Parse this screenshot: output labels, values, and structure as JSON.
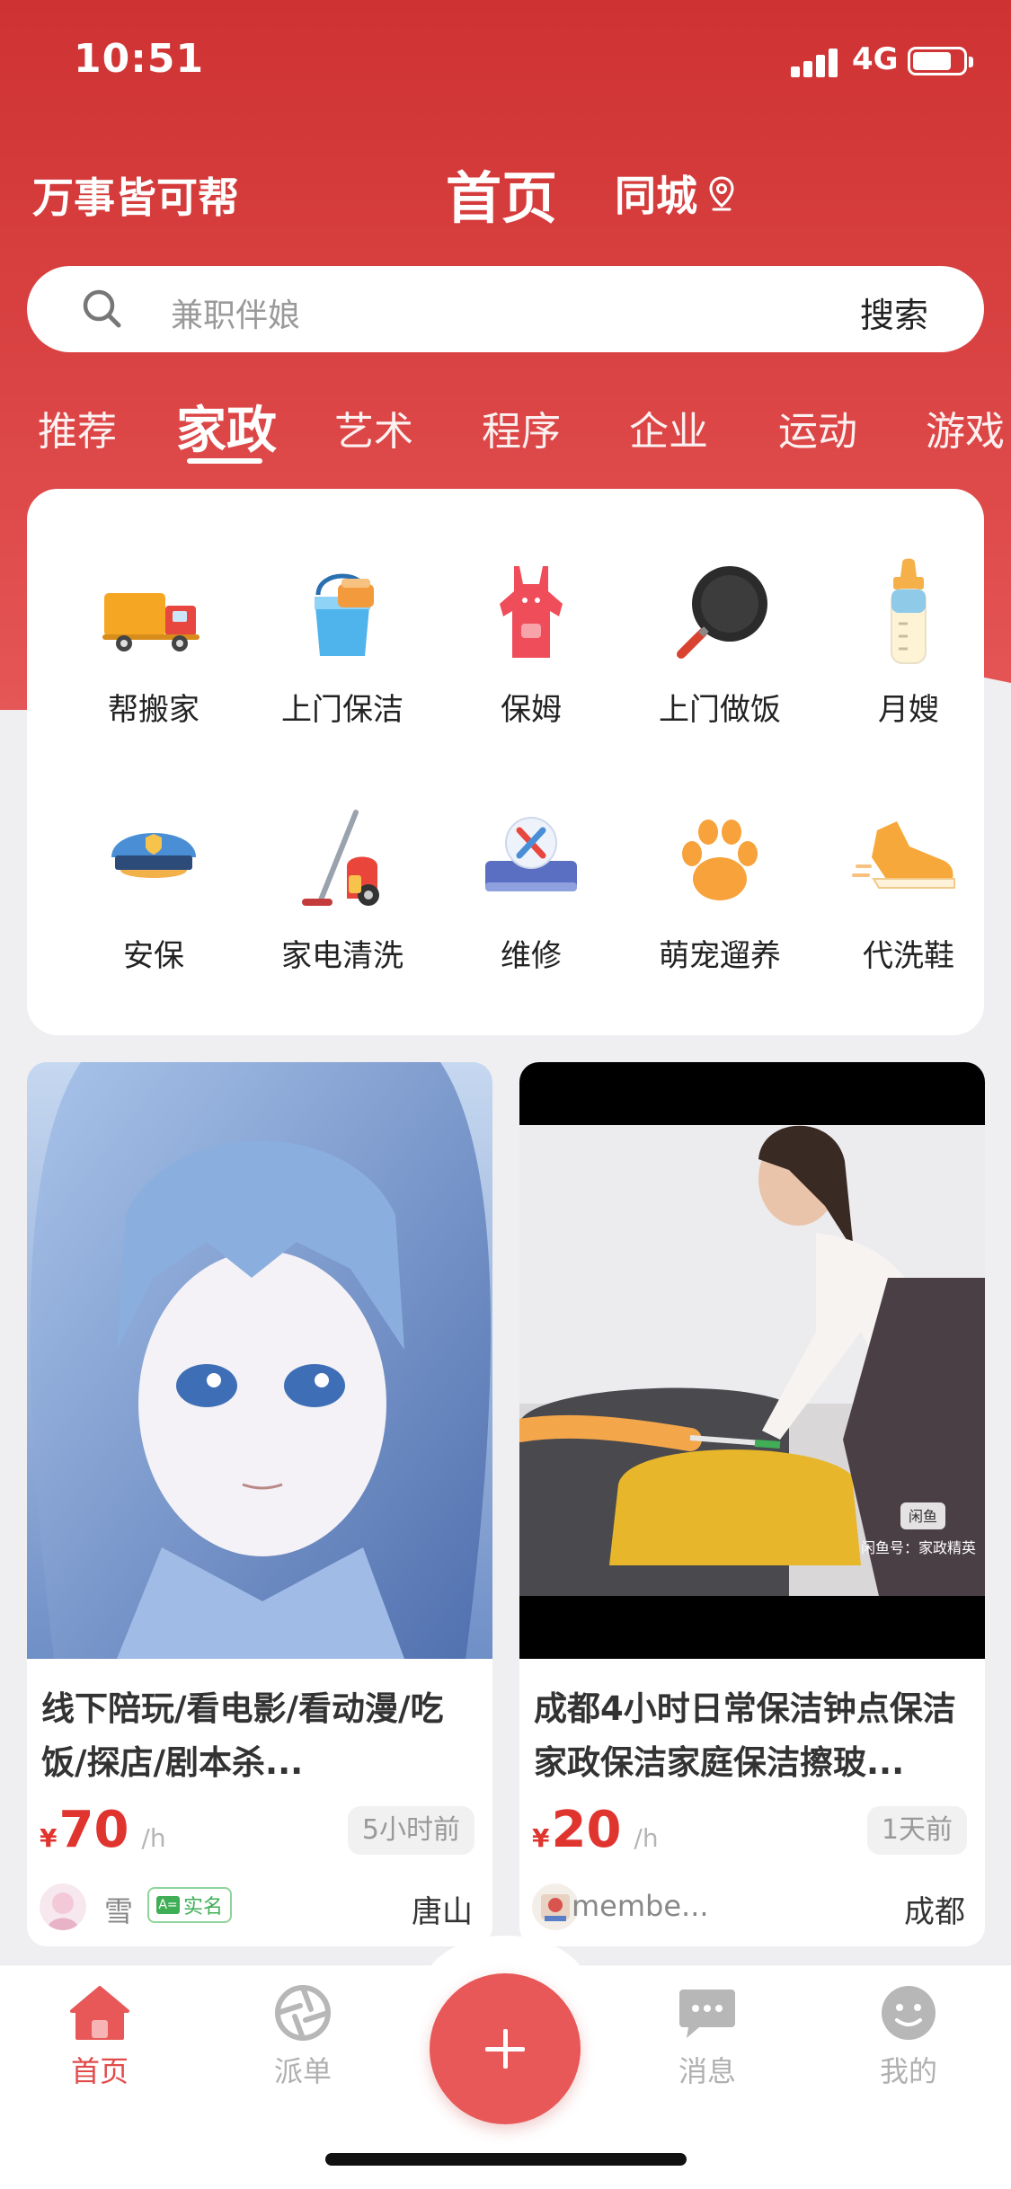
{
  "status_bar": {
    "time": "10:51",
    "network": "4G"
  },
  "header": {
    "brand": "万事皆可帮",
    "title": "首页",
    "city": "同城"
  },
  "search": {
    "placeholder": "兼职伴娘",
    "button": "搜索"
  },
  "category_tabs": [
    "推荐",
    "家政",
    "艺术",
    "程序",
    "企业",
    "运动",
    "游戏"
  ],
  "active_tab": "家政",
  "services": [
    {
      "label": "帮搬家",
      "icon": "moving-truck-icon"
    },
    {
      "label": "上门保洁",
      "icon": "cleaning-bucket-icon"
    },
    {
      "label": "保姆",
      "icon": "apron-icon"
    },
    {
      "label": "上门做饭",
      "icon": "frying-pan-icon"
    },
    {
      "label": "月嫂",
      "icon": "baby-bottle-icon"
    },
    {
      "label": "安保",
      "icon": "security-cap-icon"
    },
    {
      "label": "家电清洗",
      "icon": "vacuum-cleaner-icon"
    },
    {
      "label": "维修",
      "icon": "repair-tools-icon"
    },
    {
      "label": "萌宠遛养",
      "icon": "paw-icon"
    },
    {
      "label": "代洗鞋",
      "icon": "sneaker-icon"
    }
  ],
  "listings": [
    {
      "title": "线下陪玩/看电影/看动漫/吃饭/探店/剧本杀...",
      "currency": "¥",
      "price": "70",
      "unit": "/h",
      "time_ago": "5小时前",
      "user": "雪",
      "verified": "实名",
      "location": "唐山"
    },
    {
      "title": "成都4小时日常保洁钟点保洁家政保洁家庭保洁擦玻...",
      "currency": "¥",
      "price": "20",
      "unit": "/h",
      "time_ago": "1天前",
      "user": "membe...",
      "location": "成都",
      "watermark_logo": "闲鱼",
      "watermark_text": "闲鱼号：家政精英"
    }
  ],
  "bottom_nav": [
    {
      "label": "首页",
      "icon": "home-icon",
      "active": true
    },
    {
      "label": "派单",
      "icon": "aperture-icon",
      "active": false
    },
    {
      "label": "消息",
      "icon": "chat-bubble-icon",
      "active": false
    },
    {
      "label": "我的",
      "icon": "smiley-profile-icon",
      "active": false
    }
  ],
  "colors": {
    "brand_red": "#d63a3a",
    "price_red": "#e0352f",
    "verified_green": "#3fae56"
  }
}
